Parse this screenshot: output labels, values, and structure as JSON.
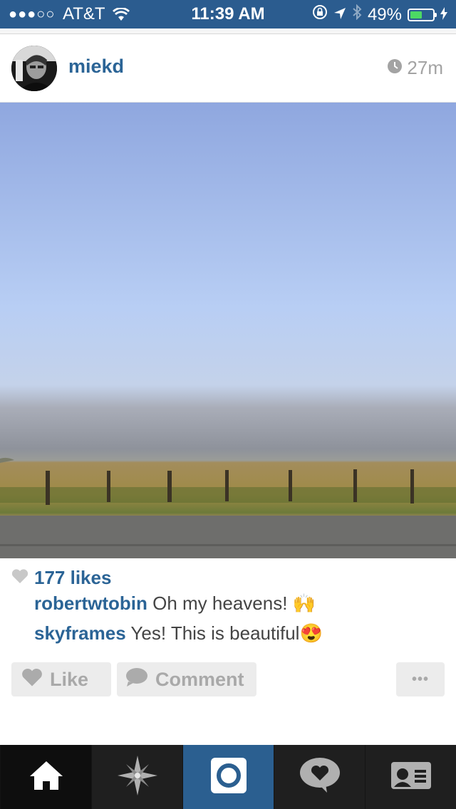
{
  "status_bar": {
    "signal": "●●●○○",
    "carrier": "AT&T",
    "time": "11:39 AM",
    "battery": "49%",
    "battery_level": 0.49
  },
  "post": {
    "username": "miekd",
    "time_ago": "27m",
    "likes": "177 likes",
    "comments": [
      {
        "user": "robertwtobin",
        "text": "Oh my heavens! 🙌"
      },
      {
        "user": "skyframes",
        "text": "Yes! This is beautiful😍"
      }
    ]
  },
  "actions": {
    "like": "Like",
    "comment": "Comment",
    "more": "•••"
  },
  "tab_bar": {
    "icons": [
      "home-icon",
      "explore-icon",
      "camera-icon",
      "activity-icon",
      "profile-icon"
    ]
  },
  "colors": {
    "accent": "#2b5c8f",
    "link": "#2b6496"
  }
}
